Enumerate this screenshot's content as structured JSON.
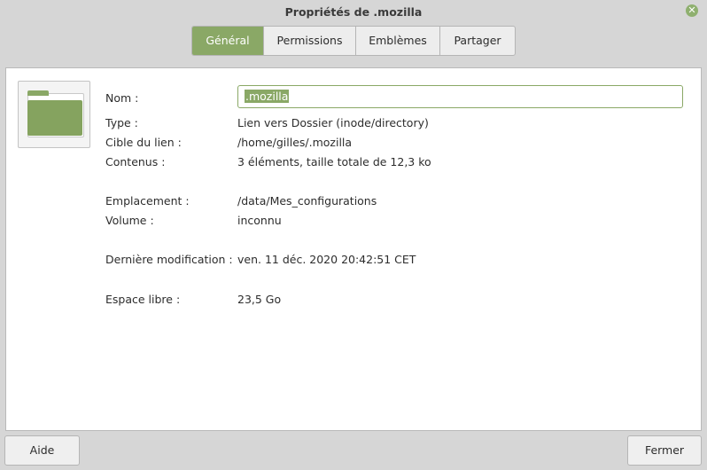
{
  "window": {
    "title": "Propriétés de .mozilla",
    "close_glyph": "✕"
  },
  "tabs": [
    "Général",
    "Permissions",
    "Emblèmes",
    "Partager"
  ],
  "general": {
    "name_label": "Nom :",
    "name_value": ".mozilla",
    "rows": {
      "type": {
        "label": "Type :",
        "value": "Lien vers Dossier (inode/directory)"
      },
      "target": {
        "label": "Cible du lien :",
        "value": "/home/gilles/.mozilla"
      },
      "contents": {
        "label": "Contenus :",
        "value": "3 éléments, taille totale de 12,3 ko"
      },
      "location": {
        "label": "Emplacement :",
        "value": "/data/Mes_configurations"
      },
      "volume": {
        "label": "Volume :",
        "value": "inconnu"
      },
      "modified": {
        "label": "Dernière modification :",
        "value": "ven. 11 déc. 2020 20:42:51 CET"
      },
      "free": {
        "label": "Espace libre :",
        "value": "23,5 Go"
      }
    },
    "icon": "folder-icon"
  },
  "buttons": {
    "help": "Aide",
    "close": "Fermer"
  },
  "colors": {
    "accent": "#8aa866"
  }
}
